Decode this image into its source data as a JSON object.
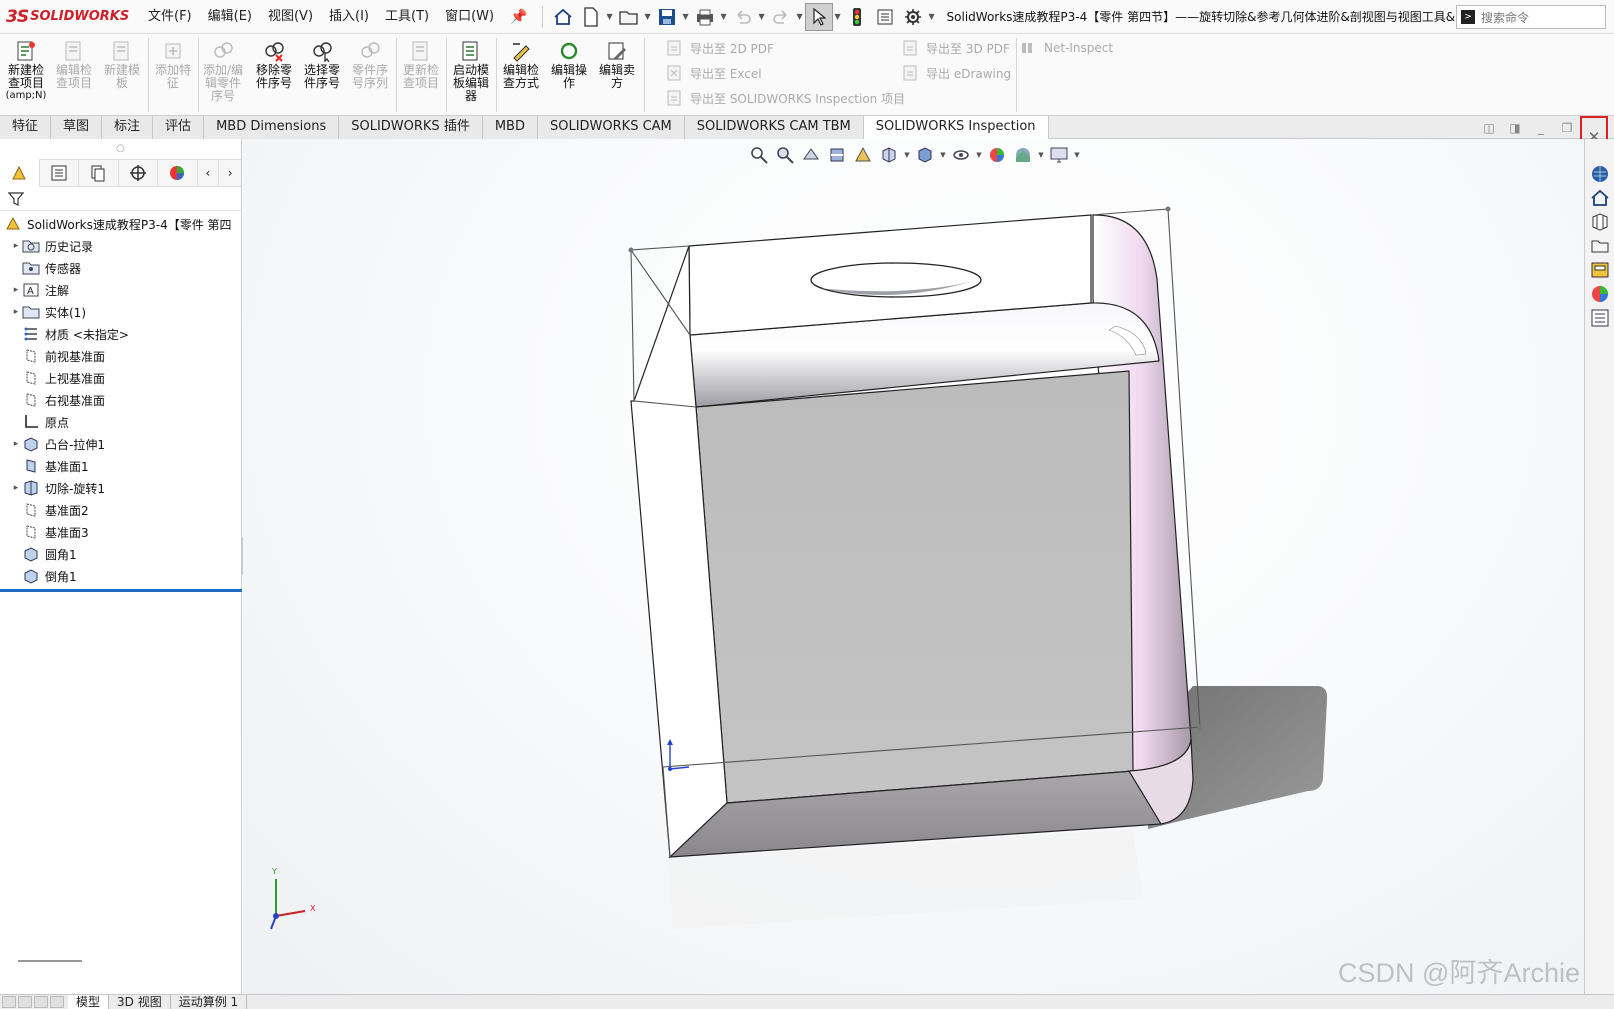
{
  "app": {
    "brand_mark": "3S",
    "brand_name": "SOLIDWORKS"
  },
  "menu": [
    "文件(F)",
    "编辑(E)",
    "视图(V)",
    "插入(I)",
    "工具(T)",
    "窗口(W)"
  ],
  "document_title": "SolidWorks速成教程P3-4【零件 第四节】——旋转切除&参考几何体进阶&剖视图与视图工具&...",
  "search": {
    "placeholder": "搜索命令"
  },
  "ribbon": {
    "buttons": [
      {
        "label": "新建检查项目",
        "sub": "(amp;N)",
        "enabled": true
      },
      {
        "label": "编辑检查项目",
        "enabled": false
      },
      {
        "label": "新建模板",
        "enabled": false
      },
      {
        "label": "添加特征",
        "enabled": false
      },
      {
        "label": "添加/编辑零件序号",
        "enabled": false
      },
      {
        "label": "移除零件序号",
        "enabled": true
      },
      {
        "label": "选择零件序号",
        "enabled": true
      },
      {
        "label": "零件序号序列",
        "enabled": false
      },
      {
        "label": "更新检查项目",
        "enabled": false
      },
      {
        "label": "启动模板编辑器",
        "enabled": true
      },
      {
        "label": "编辑检查方式",
        "enabled": true
      },
      {
        "label": "编辑操作",
        "enabled": true
      },
      {
        "label": "编辑卖方",
        "enabled": true
      }
    ],
    "exports": [
      {
        "label": "导出至 2D PDF"
      },
      {
        "label": "导出至 Excel"
      },
      {
        "label": "导出至 SOLIDWORKS Inspection 项目"
      },
      {
        "label": "导出至 3D PDF"
      },
      {
        "label": "导出 eDrawing"
      },
      {
        "label": "Net-Inspect"
      }
    ]
  },
  "tabs": [
    "特征",
    "草图",
    "标注",
    "评估",
    "MBD Dimensions",
    "SOLIDWORKS 插件",
    "MBD",
    "SOLIDWORKS CAM",
    "SOLIDWORKS CAM TBM",
    "SOLIDWORKS Inspection"
  ],
  "active_tab": "SOLIDWORKS Inspection",
  "tree": {
    "root": "SolidWorks速成教程P3-4【零件 第四",
    "items": [
      {
        "label": "历史记录",
        "expandable": true,
        "icon": "history-folder-icon"
      },
      {
        "label": "传感器",
        "expandable": false,
        "icon": "sensor-icon"
      },
      {
        "label": "注解",
        "expandable": true,
        "icon": "annotation-icon"
      },
      {
        "label": "实体(1)",
        "expandable": true,
        "icon": "solid-bodies-icon"
      },
      {
        "label": "材质 <未指定>",
        "expandable": false,
        "icon": "material-icon"
      },
      {
        "label": "前视基准面",
        "expandable": false,
        "icon": "plane-icon"
      },
      {
        "label": "上视基准面",
        "expandable": false,
        "icon": "plane-icon"
      },
      {
        "label": "右视基准面",
        "expandable": false,
        "icon": "plane-icon"
      },
      {
        "label": "原点",
        "expandable": false,
        "icon": "origin-icon"
      },
      {
        "label": "凸台-拉伸1",
        "expandable": true,
        "icon": "extrude-icon"
      },
      {
        "label": "基准面1",
        "expandable": false,
        "icon": "plane-icon"
      },
      {
        "label": "切除-旋转1",
        "expandable": true,
        "icon": "revolve-cut-icon"
      },
      {
        "label": "基准面2",
        "expandable": false,
        "icon": "plane-icon"
      },
      {
        "label": "基准面3",
        "expandable": false,
        "icon": "plane-icon"
      },
      {
        "label": "圆角1",
        "expandable": false,
        "icon": "fillet-icon"
      },
      {
        "label": "倒角1",
        "expandable": false,
        "icon": "chamfer-icon"
      }
    ]
  },
  "bottom_tabs": [
    "模型",
    "3D 视图",
    "运动算例 1"
  ],
  "triad": {
    "y_label": "Y",
    "x_label": "X"
  },
  "watermark": "CSDN @阿齐Archie",
  "colors": {
    "brand_red": "#d0202a",
    "highlight_red": "#e02020",
    "rollback_blue": "#1e6cc8"
  }
}
